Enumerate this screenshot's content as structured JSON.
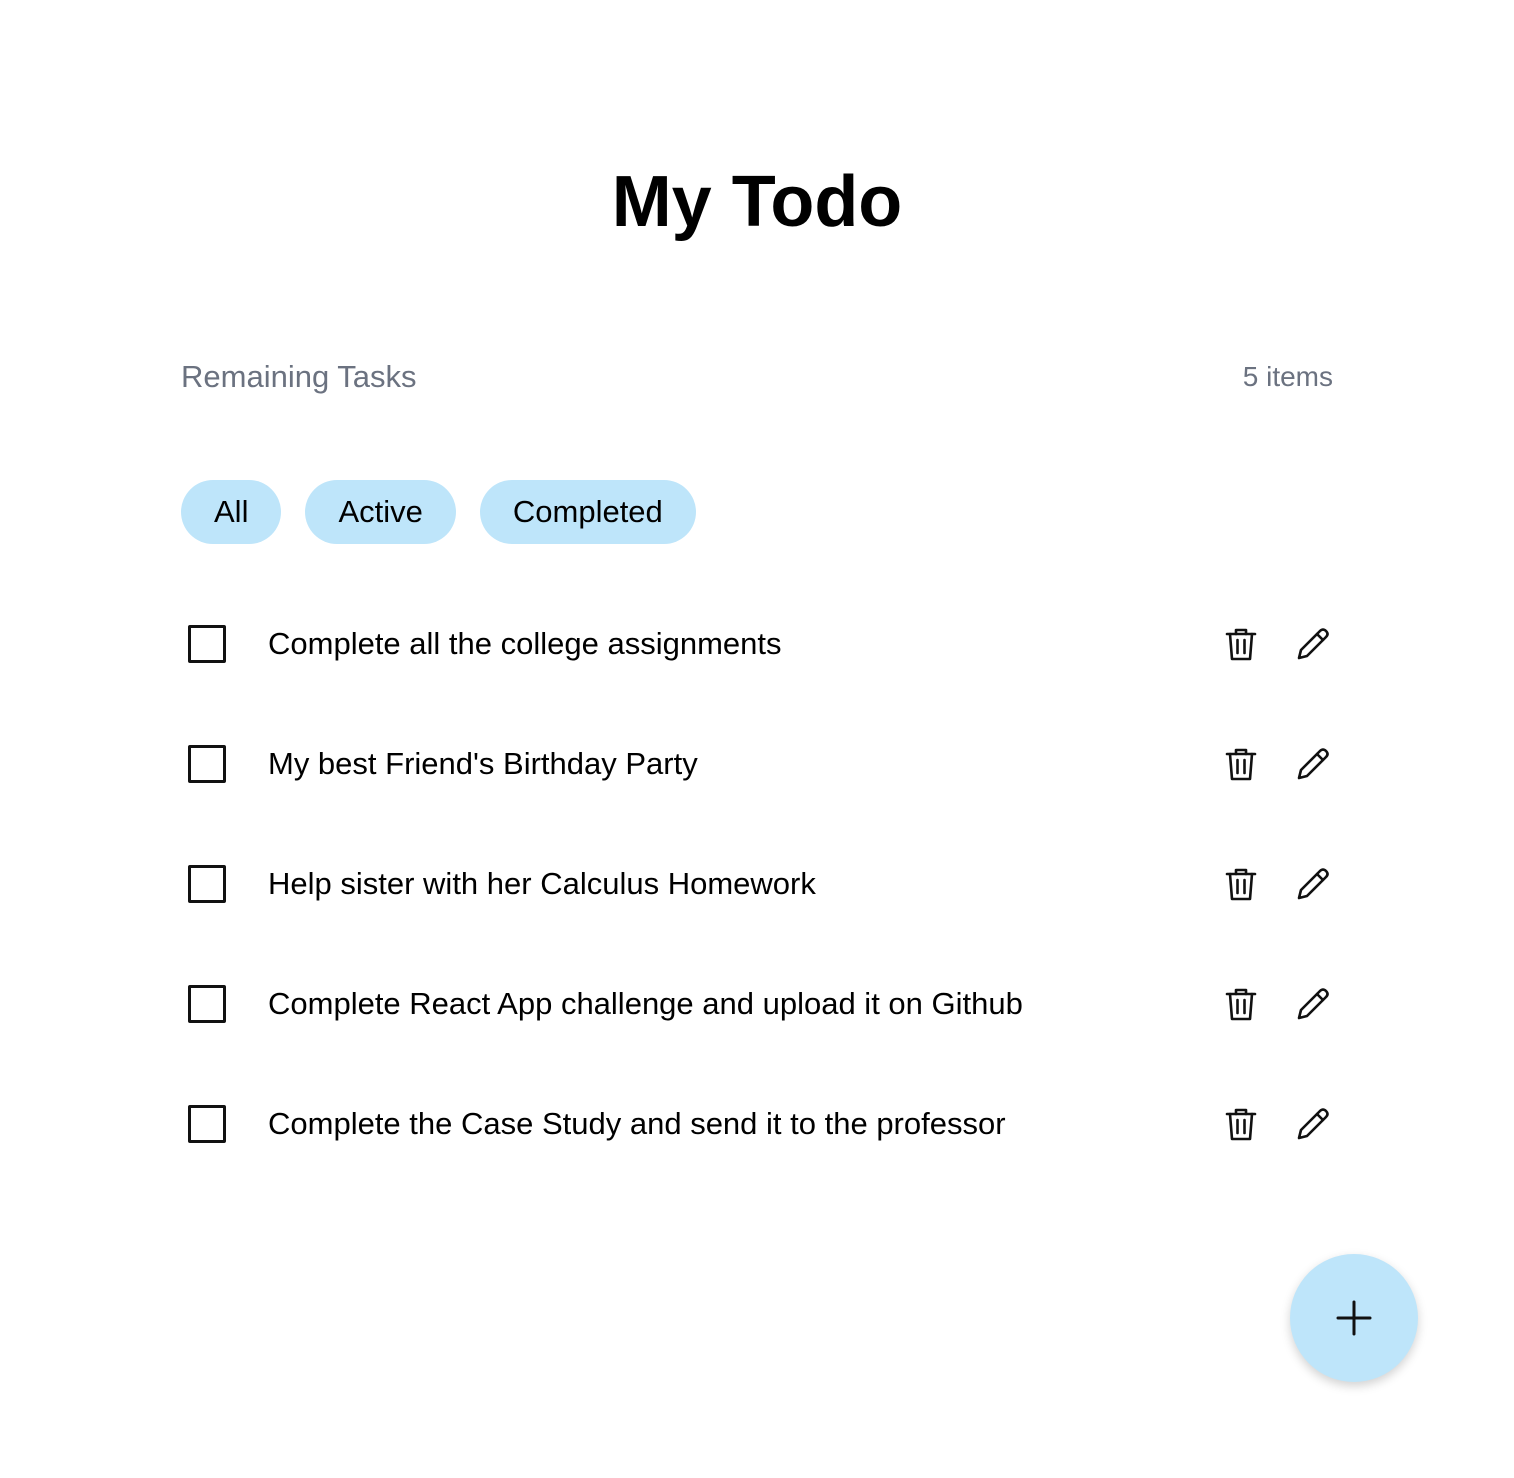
{
  "header": {
    "title": "My Todo"
  },
  "summary": {
    "label": "Remaining Tasks",
    "count": "5 items"
  },
  "filters": [
    {
      "label": "All"
    },
    {
      "label": "Active"
    },
    {
      "label": "Completed"
    }
  ],
  "tasks": [
    {
      "text": "Complete all the college assignments",
      "completed": false
    },
    {
      "text": "My best Friend's Birthday Party",
      "completed": false
    },
    {
      "text": "Help sister with her Calculus Homework",
      "completed": false
    },
    {
      "text": "Complete React App challenge and upload it on Github",
      "completed": false
    },
    {
      "text": "Complete the Case Study and send it to the professor",
      "completed": false
    }
  ],
  "icons": {
    "delete": "trash-icon",
    "edit": "pencil-icon",
    "add": "plus-icon"
  },
  "colors": {
    "accent": "#bee5fa",
    "muted_text": "#6b7280",
    "text": "#000000"
  }
}
